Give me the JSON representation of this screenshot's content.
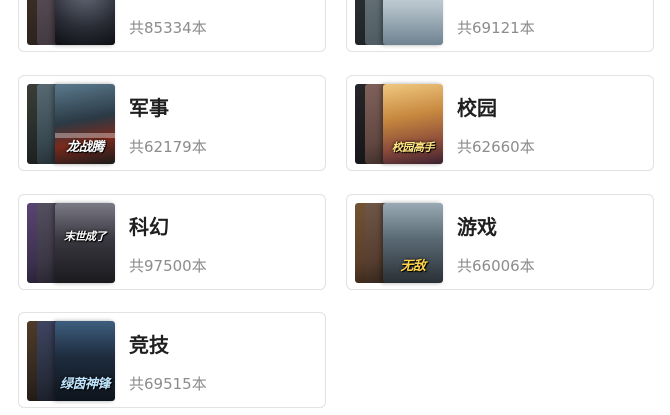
{
  "categories": [
    {
      "name": "",
      "count": "共85334本",
      "cover_title": "",
      "colors": {
        "front": "#2a2d36",
        "back1": "#4b4148",
        "back2": "#3c3028"
      }
    },
    {
      "name": "",
      "count": "共69121本",
      "cover_title": "",
      "colors": {
        "front": "#b7c4cc",
        "back1": "#5a6a72",
        "back2": "#2c3238"
      }
    },
    {
      "name": "军事",
      "count": "共62179本",
      "cover_title": "龙战腾",
      "colors": {
        "front": "#2b3a45",
        "back1": "#465a64",
        "back2": "#3a403b"
      }
    },
    {
      "name": "校园",
      "count": "共62660本",
      "cover_title": "校园高手",
      "colors": {
        "front": "#c7893f",
        "back1": "#7a5a52",
        "back2": "#1d1d22"
      }
    },
    {
      "name": "科幻",
      "count": "共97500本",
      "cover_title": "末世成了",
      "colors": {
        "front": "#3a3840",
        "back1": "#4a4456",
        "back2": "#5d4b7a"
      }
    },
    {
      "name": "游戏",
      "count": "共66006本",
      "cover_title": "无敌",
      "colors": {
        "front": "#5a6a74",
        "back1": "#6a4d3a",
        "back2": "#8a6040"
      }
    },
    {
      "name": "竞技",
      "count": "共69515本",
      "cover_title": "绿茵神锋",
      "colors": {
        "front": "#1e2c3e",
        "back1": "#30374a",
        "back2": "#4a3b2e"
      }
    }
  ]
}
